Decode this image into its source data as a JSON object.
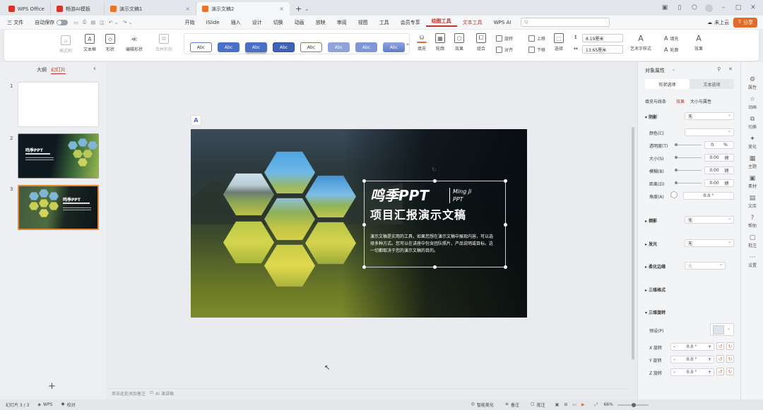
{
  "titlebar": {
    "tabs": [
      {
        "label": "WPS Office",
        "color": "#d6332b"
      },
      {
        "label": "畅游AI模板",
        "color": "#d6332b"
      },
      {
        "label": "演示文稿1",
        "color": "#e8742a"
      },
      {
        "label": "演示文稿2",
        "color": "#e8742a"
      }
    ],
    "new_tab": "+",
    "icons": [
      "layout-icon",
      "tablet-icon",
      "cube-icon",
      "avatar-icon",
      "minimize-icon",
      "maximize-icon",
      "close-icon"
    ]
  },
  "menubar": {
    "file": "三 文件",
    "autosave": "自动保存",
    "items": [
      "开始",
      "iSlide",
      "插入",
      "设计",
      "切换",
      "动画",
      "放映",
      "审阅",
      "视图",
      "工具",
      "会员专享",
      "绘图工具",
      "文本工具",
      "WPS AI"
    ],
    "active_items": [
      "绘图工具",
      "文本工具"
    ],
    "search_placeholder": "Q",
    "cloud": "未上云",
    "share": "分享",
    "accent": "#c5322b"
  },
  "ribbon": {
    "format_painter": "格式刷",
    "textbox": "文本框",
    "shape": "形状",
    "edit_shape": "编辑形状",
    "merge_shape": "合并形状",
    "styles": [
      "Abc",
      "Abc",
      "Abc",
      "Abc",
      "Abc",
      "Abc",
      "Abc",
      "Abc"
    ],
    "fill": "填充",
    "outline": "轮廓",
    "effect": "效果",
    "rotate": "旋转",
    "align": "对齐",
    "combine": "组合",
    "bring_forward": "上移",
    "send_backward": "下移",
    "select": "选择",
    "width": "8.19厘米",
    "height": "13.65厘米",
    "art_style": "艺术字样式",
    "text_fill": "填充",
    "text_outline": "轮廓",
    "text_effect": "效果"
  },
  "leftpane": {
    "tab_outline": "大纲",
    "tab_slides": "幻灯片",
    "collapse": "‹",
    "slides": [
      {
        "num": "1"
      },
      {
        "num": "2"
      },
      {
        "num": "3"
      }
    ],
    "add": "+"
  },
  "slide": {
    "title": "鸣季PPT",
    "title_en_1": "Ming Ji",
    "title_en_2": "PPT",
    "subtitle": "项目汇报演示文稿",
    "body": "演示文稿是实用的工具，如果您想在演示文稿中展现内容，可以选择多种方式。您可以在讲座中包含团队照片，产品说明或目标。这一切都取决于您的演示文稿的目的。"
  },
  "canvas": {
    "ai_badge": "A",
    "notes_placeholder": "单击此处添加备注",
    "ai_notes": "AI 演讲稿"
  },
  "rightpanel": {
    "header": "对象属性",
    "tab_shape": "形状选项",
    "tab_text": "文本选项",
    "subtabs": [
      "填充与线条",
      "效果",
      "大小与属性"
    ],
    "active_subtab": "效果",
    "shadow": {
      "label": "阴影",
      "value": "无",
      "color_label": "颜色(C)",
      "transparency_label": "透明度(T)",
      "transparency": "0",
      "transparency_unit": "%",
      "size_label": "大小(S)",
      "size": "0.00",
      "size_unit": "磅",
      "blur_label": "模糊(B)",
      "blur": "0.00",
      "blur_unit": "磅",
      "distance_label": "距离(D)",
      "distance": "0.00",
      "distance_unit": "磅",
      "angle_label": "角度(A)",
      "angle": "0.0 °"
    },
    "reflection": {
      "label": "倒影",
      "value": "无"
    },
    "glow": {
      "label": "发光",
      "value": "无"
    },
    "soft_edge": {
      "label": "柔化边缘",
      "value": "无"
    },
    "format_3d": {
      "label": "三维格式"
    },
    "rotation_3d": {
      "label": "三维旋转",
      "preset_label": "预设(P)",
      "x_label": "X 旋转",
      "x": "0.0 °",
      "y_label": "Y 旋转",
      "y": "0.0 °",
      "z_label": "Z 旋转",
      "z": "0.0 °"
    }
  },
  "sideicons": [
    "属性",
    "动画",
    "切换",
    "美化",
    "主题",
    "素材",
    "文库",
    "帮助",
    "批注",
    "设置"
  ],
  "statusbar": {
    "slide_count": "幻灯片 3 / 3",
    "theme": "WPS",
    "proof": "校对",
    "beautify": "智能美化",
    "notes": "备注",
    "comments": "批注",
    "zoom": "66%"
  }
}
